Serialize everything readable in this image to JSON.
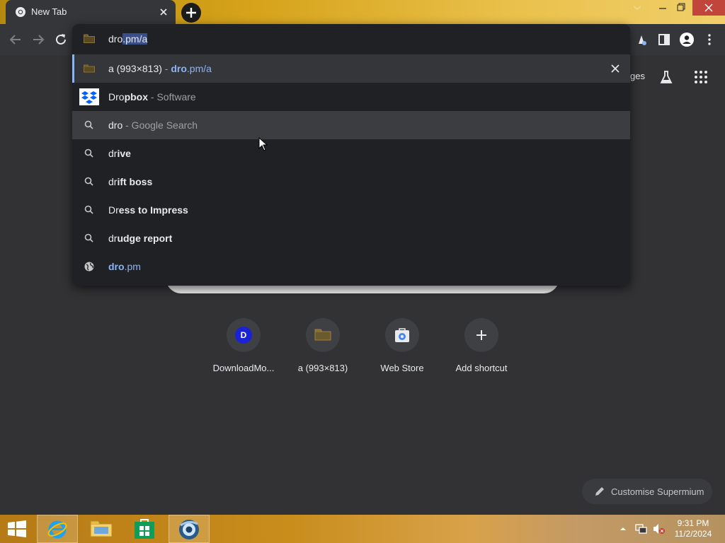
{
  "window": {
    "tab_title": "New Tab",
    "accent_colors": {
      "titlebar": "#d6a31a",
      "close_button": "#c2453b",
      "link": "#8ab4f8"
    }
  },
  "toolbar": {
    "icons": [
      "back-icon",
      "forward-icon",
      "reload-icon",
      "extension-icon",
      "side-panel-icon",
      "profile-icon",
      "menu-icon"
    ]
  },
  "omnibox": {
    "typed": "dro",
    "autocomplete": ".pm/a",
    "suggestions": [
      {
        "icon": "bookmark-folder-icon",
        "prefix": "a (993×813)",
        "sep": " - ",
        "url_bold": "dro",
        "url_rest": ".pm/a",
        "removable": true
      },
      {
        "icon": "dropbox-icon",
        "plain": "Dro",
        "bold": "pbox",
        "suffix": " - Software"
      },
      {
        "icon": "search-icon",
        "plain": "dro",
        "suffix": " - Google Search"
      },
      {
        "icon": "search-icon",
        "plain": "dr",
        "bold": "ive"
      },
      {
        "icon": "search-icon",
        "plain": "dr",
        "bold": "ift boss"
      },
      {
        "icon": "search-icon",
        "plain": "Dr",
        "bold": "ess to Impress"
      },
      {
        "icon": "search-icon",
        "plain": "dr",
        "bold": "udge report"
      },
      {
        "icon": "globe-icon",
        "url_bold": "dro",
        "url_rest": ".pm"
      }
    ]
  },
  "ntp": {
    "behind_dropdown": {
      "right_text": "ges"
    },
    "shortcuts": [
      {
        "label": "DownloadMo...",
        "badge": "D"
      },
      {
        "label": "a (993×813)"
      },
      {
        "label": "Web Store"
      },
      {
        "label": "Add shortcut"
      }
    ],
    "customise_label": "Customise Supermium"
  },
  "taskbar": {
    "apps": [
      "start-button",
      "internet-explorer-icon",
      "file-explorer-icon",
      "store-icon",
      "supermium-icon"
    ],
    "clock_time": "9:31 PM",
    "clock_date": "11/2/2024"
  }
}
